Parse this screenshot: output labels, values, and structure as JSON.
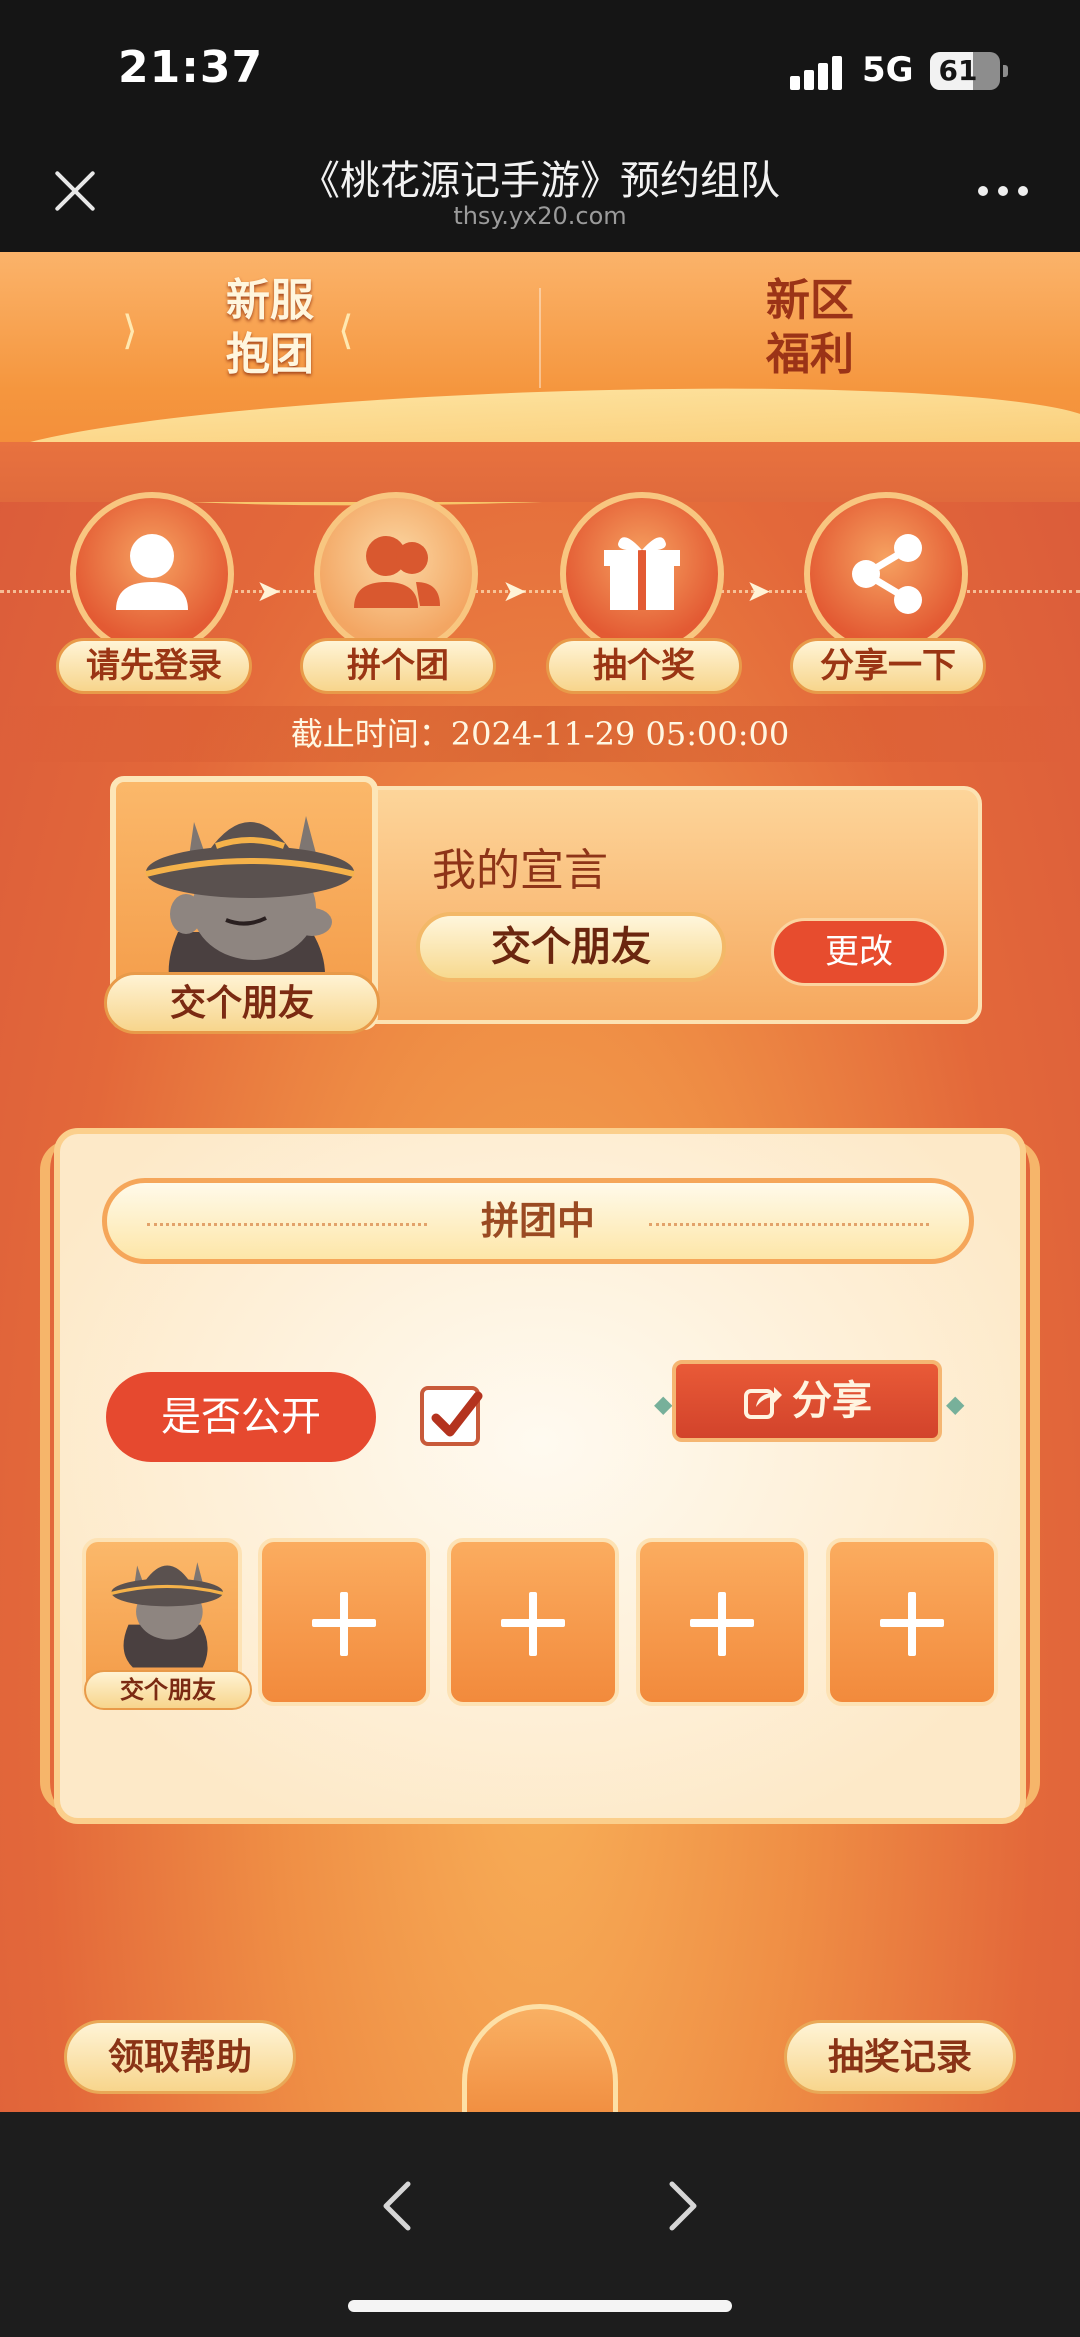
{
  "status_bar": {
    "time": "21:37",
    "network": "5G",
    "battery": "61"
  },
  "browser": {
    "title": "《桃花源记手游》预约组队",
    "url": "thsy.yx20.com"
  },
  "tabs": {
    "left": "新服\n抱团",
    "right": "新区\n福利"
  },
  "steps": [
    {
      "label": "请先登录",
      "icon": "user-icon"
    },
    {
      "label": "拼个团",
      "icon": "group-icon"
    },
    {
      "label": "抽个奖",
      "icon": "gift-icon"
    },
    {
      "label": "分享一下",
      "icon": "share-icon"
    }
  ],
  "deadline": "截止时间：2024-11-29 05:00:00",
  "declaration": {
    "title": "我的宣言",
    "text": "交个朋友",
    "change_label": "更改",
    "avatar_tag": "交个朋友"
  },
  "team": {
    "status": "拼团中",
    "public_label": "是否公开",
    "public_checked": true,
    "share_label": "分享",
    "member_tag": "交个朋友",
    "empty_slots": 4
  },
  "bottom": {
    "help_label": "领取帮助",
    "records_label": "抽奖记录"
  },
  "colors": {
    "accent_red": "#e74c2e",
    "gold": "#f7d58c",
    "text_brown": "#9a3514"
  }
}
